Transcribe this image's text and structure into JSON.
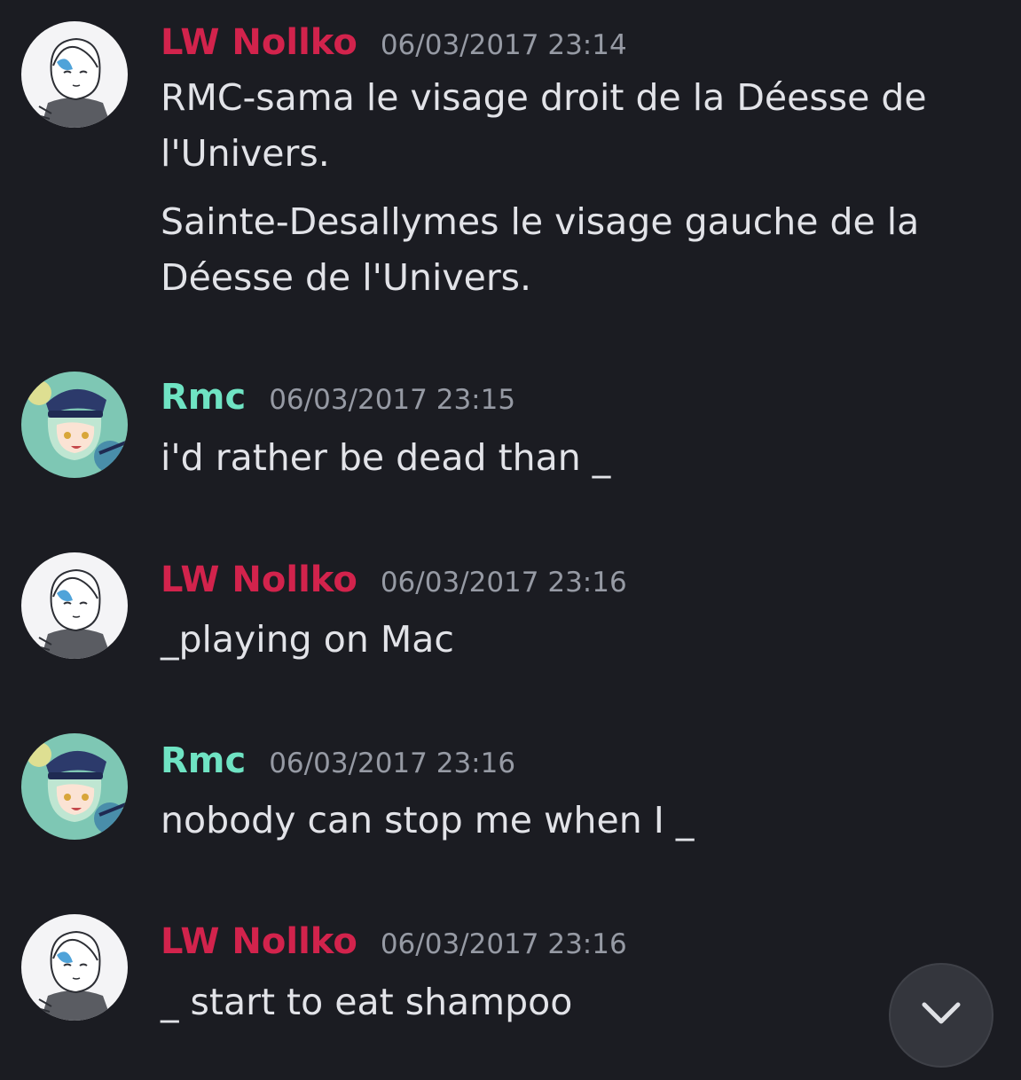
{
  "colors": {
    "background": "#1b1c22",
    "author_lw": "#d2234c",
    "author_rmc": "#6fe3c3",
    "timestamp": "#969aa4",
    "text": "#e2e3e8",
    "scroll_button": "#34363d"
  },
  "messages": [
    {
      "author": "LW Nollko",
      "timestamp": "06/03/2017 23:14",
      "avatar": "sketch-girl-avatar",
      "paragraphs": [
        "RMC-sama le visage droit de la Déesse de l'Univers.",
        "Sainte-Desallymes le visage gauche de la Déesse de l'Univers."
      ]
    },
    {
      "author": "Rmc",
      "timestamp": "06/03/2017 23:15",
      "avatar": "anime-girl-cap-avatar",
      "paragraphs": [
        "i'd rather be dead than _"
      ]
    },
    {
      "author": "LW Nollko",
      "timestamp": "06/03/2017 23:16",
      "avatar": "sketch-girl-avatar",
      "paragraphs": [
        "_playing on Mac"
      ]
    },
    {
      "author": "Rmc",
      "timestamp": "06/03/2017 23:16",
      "avatar": "anime-girl-cap-avatar",
      "paragraphs": [
        "nobody can stop me when I _"
      ]
    },
    {
      "author": "LW Nollko",
      "timestamp": "06/03/2017 23:16",
      "avatar": "sketch-girl-avatar",
      "paragraphs": [
        "_ start to eat shampoo"
      ]
    }
  ],
  "scroll_to_bottom": {
    "icon": "chevron-down-icon"
  }
}
